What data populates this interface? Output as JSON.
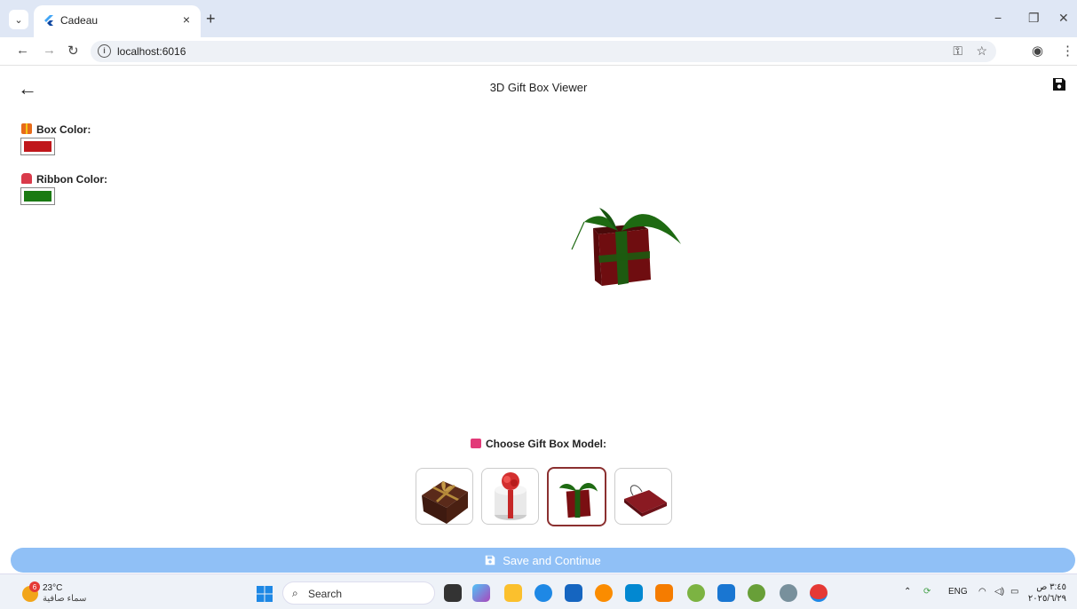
{
  "browser": {
    "tab_title": "Cadeau",
    "url": "localhost:6016",
    "new_tab": "+",
    "tab_close": "×",
    "minimize": "−",
    "restore": "❐",
    "close": "✕"
  },
  "app": {
    "title": "3D Gift Box Viewer",
    "box_color_label": "Box Color:",
    "box_color": "#c0171b",
    "ribbon_color_label": "Ribbon Color:",
    "ribbon_color": "#1a7a12",
    "choose_label": "Choose Gift Box Model:",
    "models": [
      {
        "name": "brown-box-gold-ribbon",
        "selected": false
      },
      {
        "name": "round-white-box-red-bow",
        "selected": false
      },
      {
        "name": "red-box-green-ribbon",
        "selected": true
      },
      {
        "name": "red-gift-bag",
        "selected": false
      }
    ],
    "save_button": "Save and Continue"
  },
  "taskbar": {
    "weather_badge": "6",
    "temperature": "23°C",
    "weather_desc": "سماء صافية",
    "search_placeholder": "Search",
    "language": "ENG",
    "time": "٣:٤٥ ص",
    "date": "٢٠٢٥/٦/٢٩"
  },
  "colors": {
    "accent": "#90c0f6",
    "selected_border": "#8b3030"
  }
}
